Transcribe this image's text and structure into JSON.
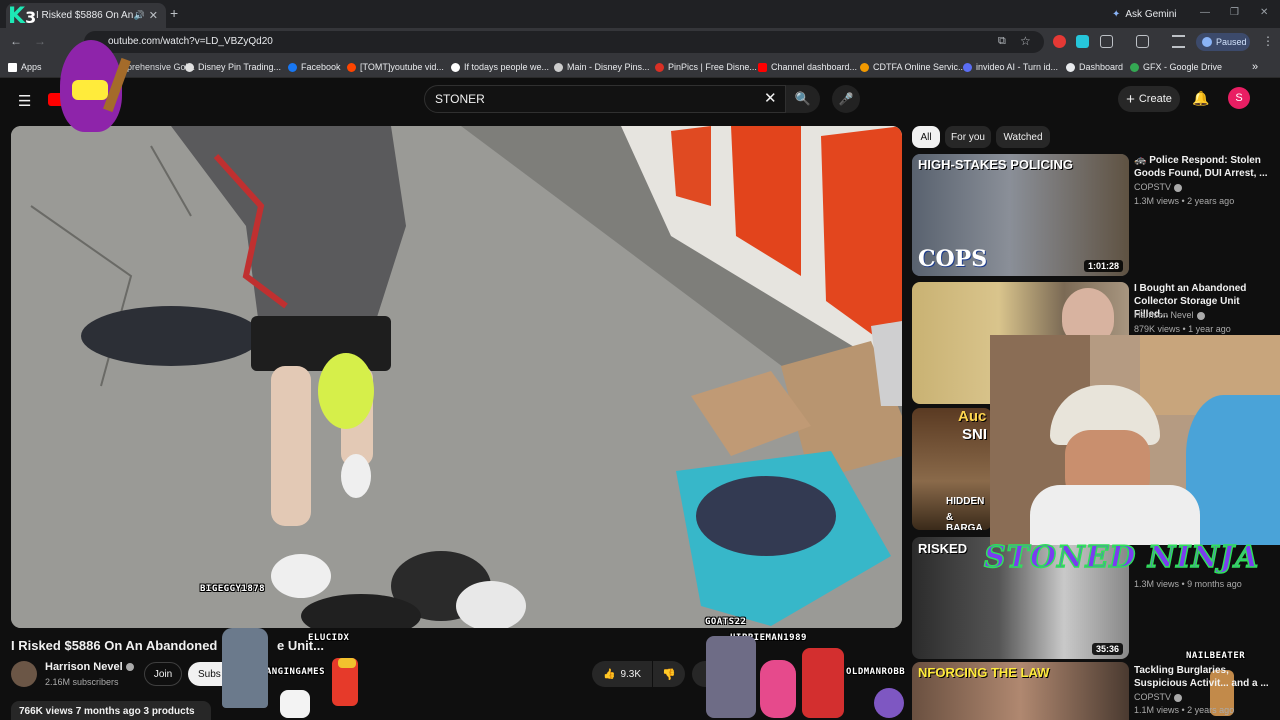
{
  "browser": {
    "tab_title": "I Risked $5886 On An Aband...",
    "ask_gemini": "Ask Gemini",
    "url": "outube.com/watch?v=LD_VBZyQd20",
    "profile_status": "Paused",
    "bookmarks": [
      {
        "label": "Apps",
        "color": "#ffffff"
      },
      {
        "label": "Comprehensive Gol...",
        "color": "#f4b400"
      },
      {
        "label": "Disney Pin Trading...",
        "color": "#e0e0e0"
      },
      {
        "label": "Facebook",
        "color": "#1877f2"
      },
      {
        "label": "[TOMT]youtube vid...",
        "color": "#ff4500"
      },
      {
        "label": "If todays people we...",
        "color": "#ffffff"
      },
      {
        "label": "Main - Disney Pins...",
        "color": "#cccccc"
      },
      {
        "label": "PinPics | Free Disne...",
        "color": "#d93025"
      },
      {
        "label": "Channel dashboard...",
        "color": "#ff0000"
      },
      {
        "label": "CDTFA Online Servic...",
        "color": "#f29900"
      },
      {
        "label": "invideo AI - Turn id...",
        "color": "#5b6ef5"
      },
      {
        "label": "Dashboard",
        "color": "#e8eaed"
      },
      {
        "label": "GFX - Google Drive",
        "color": "#34a853"
      }
    ]
  },
  "youtube": {
    "search_value": "STONER",
    "create_label": "Create",
    "avatar_letter": "S"
  },
  "video": {
    "title": "I Risked $5886 On An Abandoned",
    "title_tail": "e Unit...",
    "channel": "Harrison Nevel",
    "subscribers": "2.16M subscribers",
    "join": "Join",
    "subscribe": "Subs",
    "likes": "9.3K",
    "meta": "766K views  7 months ago  3 products"
  },
  "chips": [
    "All",
    "For you",
    "Watched"
  ],
  "recommendations": [
    {
      "title": "Police Respond: Stolen Goods Found, DUI Arrest, ...",
      "channel": "COPSTV",
      "stats": "1.3M views • 2 years ago",
      "duration": "1:01:28",
      "thumb_top": "HIGH-STAKES POLICING",
      "thumb_bottom": "COPS"
    },
    {
      "title": "I Bought an Abandoned Collector Storage Unit Filled...",
      "channel": "Harrison Nevel",
      "stats": "879K views • 1 year ago",
      "duration": "",
      "thumb_top": "",
      "thumb_bottom": ""
    },
    {
      "title": "",
      "channel": "",
      "stats": "",
      "duration": "",
      "thumb_top": "Auc",
      "thumb_mid": "SNI",
      "thumb_bottom": "HIDDEN",
      "thumb_bottom2": "& BARGA"
    },
    {
      "title": "",
      "channel": "",
      "stats": "1.3M views • 9 months ago",
      "duration": "35:36",
      "thumb_top": "RISKED",
      "thumb_bottom": ""
    },
    {
      "title": "Tackling Burglaries, Suspicious Activit... and a ...",
      "channel": "COPSTV",
      "stats": "1.1M views • 2 years ago",
      "duration": "",
      "thumb_top": "NFORCING THE LAW",
      "thumb_bottom": ""
    }
  ],
  "overlay": {
    "stoned_ninja": "STONED NINJA",
    "usernames": [
      {
        "name": "BIGEGGY1878"
      },
      {
        "name": "GOATS22"
      },
      {
        "name": "ELUCIDX"
      },
      {
        "name": "HIPPIEMAN1989"
      },
      {
        "name": "SLANGINGAMES"
      },
      {
        "name": "OLDMANROBB"
      },
      {
        "name": "NAILBEATER"
      }
    ],
    "logo_k": "K",
    "logo_3": "3"
  },
  "colors": {
    "bg": "#0f0f0f",
    "accent_red": "#ff0000",
    "chip_active": "#f1f1f1",
    "overlay_purple": "#7b3df0",
    "overlay_green": "#2fe05a"
  }
}
